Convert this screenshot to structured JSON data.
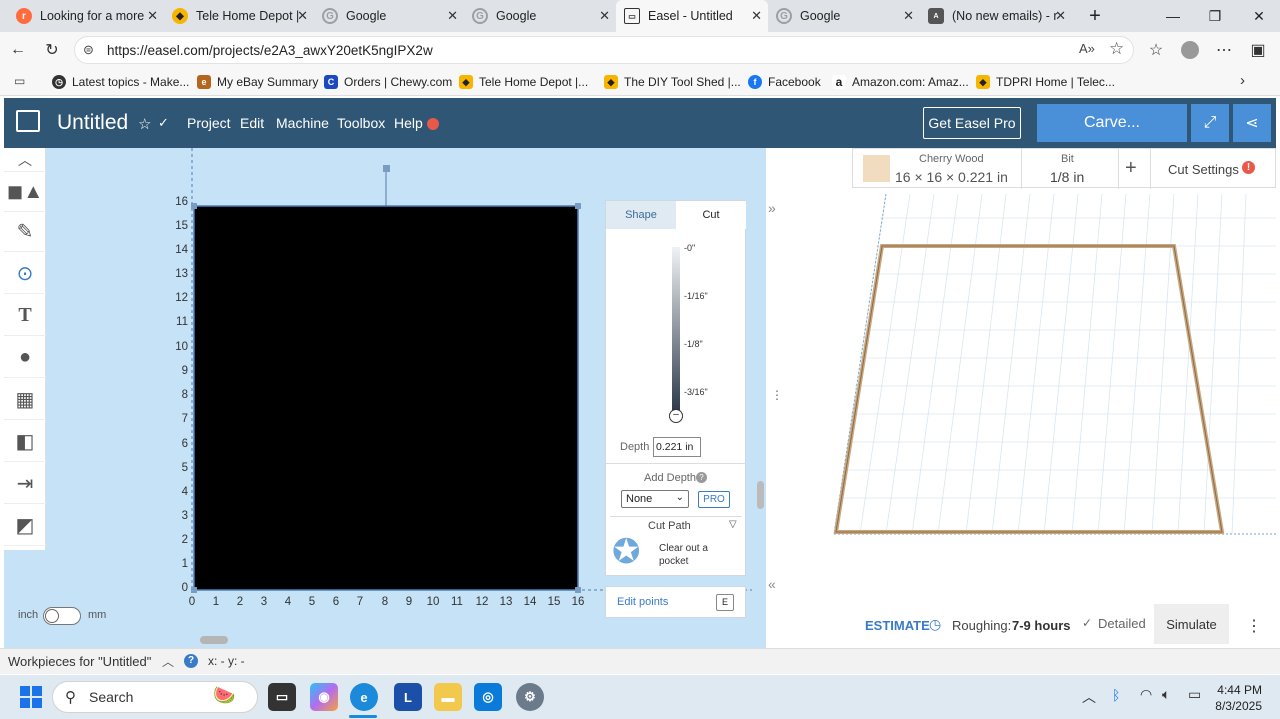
{
  "browser": {
    "tabs": [
      {
        "label": "Looking for a more",
        "icon": "reddit-icon",
        "color": "#ff6b3d",
        "active": false
      },
      {
        "label": "Tele Home Depot |",
        "icon": "home-depot-icon",
        "color": "#f7b500",
        "active": false
      },
      {
        "label": "Google",
        "icon": "google-icon",
        "color": "#4285f4",
        "active": false
      },
      {
        "label": "Google",
        "icon": "google-icon",
        "color": "#4285f4",
        "active": false
      },
      {
        "label": "Easel - Untitled",
        "icon": "easel-icon",
        "color": "#2f5675",
        "active": true
      },
      {
        "label": "Google",
        "icon": "google-icon",
        "color": "#4285f4",
        "active": false
      },
      {
        "label": "(No new emails) - r",
        "icon": "aol-icon",
        "color": "#555555",
        "active": false
      }
    ],
    "url": "https://easel.com/projects/e2A3_awxY20etK5ngIPX2w",
    "bookmarks": [
      {
        "label": "Latest topics - Make...",
        "icon": "clock-icon",
        "color": "#333333"
      },
      {
        "label": "My eBay Summary",
        "icon": "ebay-icon",
        "color": "#b5651d"
      },
      {
        "label": "Orders | Chewy.com",
        "icon": "chewy-icon",
        "color": "#1c49c2"
      },
      {
        "label": "Tele Home Depot |...",
        "icon": "home-depot-icon",
        "color": "#f7b500"
      },
      {
        "label": "The DIY Tool Shed |...",
        "icon": "home-depot-icon",
        "color": "#f7b500"
      },
      {
        "label": "Facebook",
        "icon": "facebook-icon",
        "color": "#1877f2"
      },
      {
        "label": "Amazon.com: Amaz...",
        "icon": "amazon-icon",
        "color": "#222222"
      },
      {
        "label": "TDPRI Home | Telec...",
        "icon": "home-depot-icon",
        "color": "#f7b500"
      }
    ]
  },
  "easel": {
    "title": "Untitled",
    "menu": [
      "Project",
      "Edit",
      "Machine",
      "Toolbox",
      "Help"
    ],
    "get_pro": "Get Easel Pro",
    "carve": "Carve...",
    "accent": "#4a90d9",
    "header_color": "#2f5675"
  },
  "canvas": {
    "y_ticks": [
      "16",
      "15",
      "14",
      "13",
      "12",
      "11",
      "10",
      "9",
      "8",
      "7",
      "6",
      "5",
      "4",
      "3",
      "2",
      "1",
      "0"
    ],
    "x_ticks": [
      "0",
      "1",
      "2",
      "3",
      "4",
      "5",
      "6",
      "7",
      "8",
      "9",
      "10",
      "11",
      "12",
      "13",
      "14",
      "15",
      "16"
    ],
    "unit_left": "inch",
    "unit_right": "mm"
  },
  "panel": {
    "tab_shape": "Shape",
    "tab_cut": "Cut",
    "depth_marks": [
      "-0\"",
      "-1/16\"",
      "-1/8\"",
      "-3/16\""
    ],
    "depth_label": "Depth",
    "depth_value": "0.221",
    "depth_unit": "in",
    "add_depth_label": "Add Depth",
    "add_depth_value": "None",
    "pro_badge": "PRO",
    "cut_path_label": "Cut Path",
    "cut_path_desc": "Clear out a pocket",
    "edit_points": "Edit points",
    "edit_points_key": "E"
  },
  "material": {
    "name": "Cherry Wood",
    "dims": "16 × 16 × 0.221 in",
    "bit_label": "Bit",
    "bit_value": "1/8 in",
    "cut_settings": "Cut Settings"
  },
  "estimate": {
    "label": "ESTIMATE",
    "roughing_label": "Roughing:",
    "roughing_value": "7-9 hours",
    "detailed": "Detailed",
    "simulate": "Simulate"
  },
  "status": {
    "workpieces": "Workpieces for \"Untitled\"",
    "coords": "x: - y: -"
  },
  "taskbar": {
    "search": "Search",
    "time": "4:44 PM",
    "date": "8/3/2025"
  }
}
